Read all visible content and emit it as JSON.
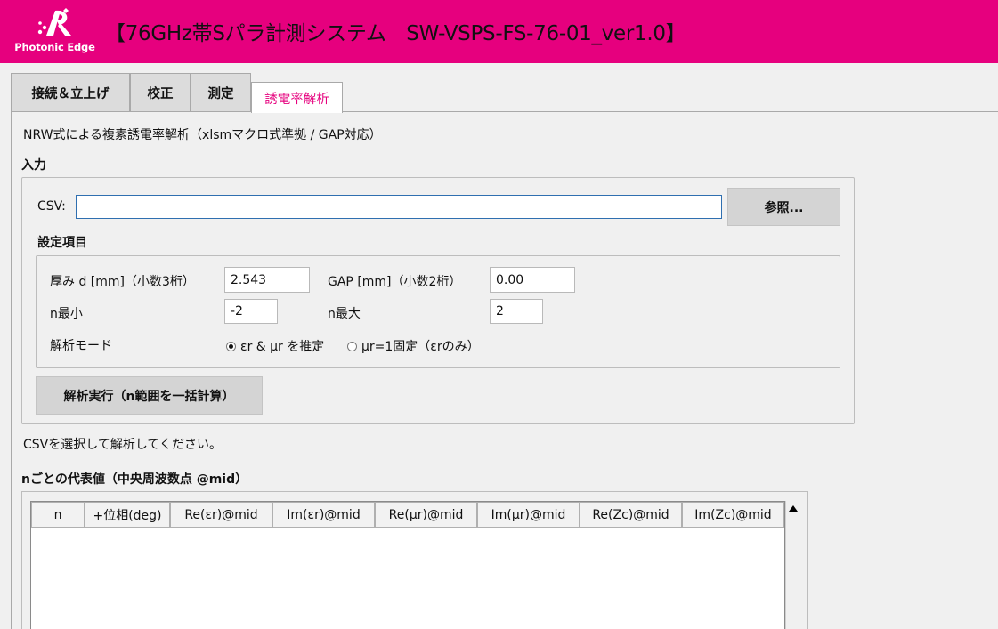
{
  "header": {
    "logo_text": "Photonic Edge",
    "title": "【76GHz帯Sパラ計測システム　SW-VSPS-FS-76-01_ver1.0】",
    "accent_color": "#e6007e"
  },
  "tabs": [
    {
      "label": "接続＆立上げ"
    },
    {
      "label": "校正"
    },
    {
      "label": "測定"
    },
    {
      "label": "誘電率解析"
    }
  ],
  "main": {
    "description": "NRW式による複素誘電率解析（xlsmマクロ式準拠 / GAP対応）",
    "input_section": {
      "title": "入力",
      "csv_label": "CSV:",
      "csv_value": "",
      "browse_button": "参照..."
    },
    "settings": {
      "title": "設定項目",
      "thickness_label": "厚み d [mm]（小数3桁）",
      "thickness_value": "2.543",
      "gap_label": "GAP [mm]（小数2桁）",
      "gap_value": "0.00",
      "n_min_label": "n最小",
      "n_min_value": "-2",
      "n_max_label": "n最大",
      "n_max_value": "2",
      "mode_label": "解析モード",
      "mode_options": [
        {
          "label": "εr & μr を推定",
          "checked": true
        },
        {
          "label": "μr=1固定（εrのみ）",
          "checked": false
        }
      ]
    },
    "run_button": "解析実行（n範囲を一括計算）",
    "status": "CSVを選択して解析してください。",
    "results": {
      "title": "nごとの代表値（中央周波数点 @mid）",
      "columns": [
        "n",
        "+位相(deg)",
        "Re(εr)@mid",
        "Im(εr)@mid",
        "Re(μr)@mid",
        "Im(μr)@mid",
        "Re(Zc)@mid",
        "Im(Zc)@mid"
      ],
      "rows": []
    }
  }
}
